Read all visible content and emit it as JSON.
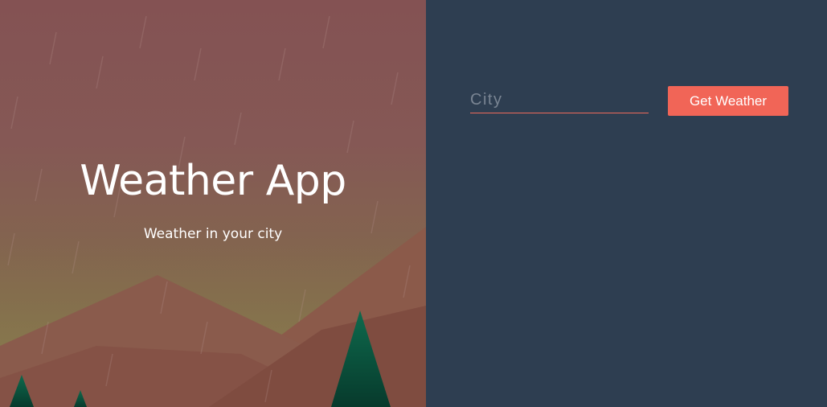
{
  "hero": {
    "title": "Weather App",
    "subtitle": "Weather in your city"
  },
  "form": {
    "city_placeholder": "City",
    "city_value": "",
    "submit_label": "Get Weather"
  },
  "colors": {
    "panel_bg": "#2e3e51",
    "accent": "#f16557",
    "hero_top": "#845253",
    "hero_mid": "#82704d",
    "tree": "#0b5740"
  }
}
